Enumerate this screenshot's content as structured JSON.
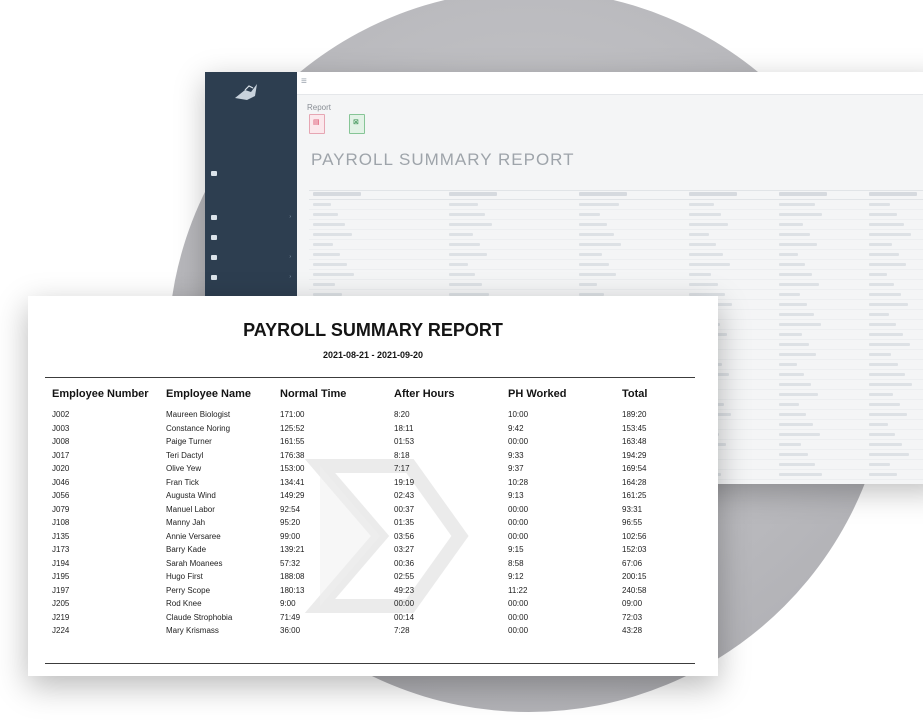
{
  "app": {
    "report_label": "Report",
    "title": "PAYROLL SUMMARY REPORT",
    "icons": {
      "menu": "hamburger-icon",
      "pdf": "pdf-file-icon",
      "excel": "excel-file-icon"
    }
  },
  "report": {
    "title": "PAYROLL SUMMARY REPORT",
    "date_range": "2021-08-21 - 2021-09-20",
    "columns": [
      "Employee Number",
      "Employee Name",
      "Normal Time",
      "After Hours",
      "PH Worked",
      "Total"
    ],
    "rows": [
      [
        "J002",
        "Maureen Biologist",
        "171:00",
        "8:20",
        "10:00",
        "189:20"
      ],
      [
        "J003",
        "Constance Noring",
        "125:52",
        "18:11",
        "9:42",
        "153:45"
      ],
      [
        "J008",
        "Paige Turner",
        "161:55",
        "01:53",
        "00:00",
        "163:48"
      ],
      [
        "J017",
        "Teri Dactyl",
        "176:38",
        "8:18",
        "9:33",
        "194:29"
      ],
      [
        "J020",
        "Olive Yew",
        "153:00",
        "7:17",
        "9:37",
        "169:54"
      ],
      [
        "J046",
        "Fran Tick",
        "134:41",
        "19:19",
        "10:28",
        "164:28"
      ],
      [
        "J056",
        "Augusta Wind",
        "149:29",
        "02:43",
        "9:13",
        "161:25"
      ],
      [
        "J079",
        "Manuel Labor",
        "92:54",
        "00:37",
        "00:00",
        "93:31"
      ],
      [
        "J108",
        "Manny Jah",
        "95:20",
        "01:35",
        "00:00",
        "96:55"
      ],
      [
        "J135",
        "Annie Versaree",
        "99:00",
        "03:56",
        "00:00",
        "102:56"
      ],
      [
        "J173",
        "Barry Kade",
        "139:21",
        "03:27",
        "9:15",
        "152:03"
      ],
      [
        "J194",
        "Sarah Moanees",
        "57:32",
        "00:36",
        "8:58",
        "67:06"
      ],
      [
        "J195",
        "Hugo First",
        "188:08",
        "02:55",
        "9:12",
        "200:15"
      ],
      [
        "J197",
        "Perry Scope",
        "180:13",
        "49:23",
        "11:22",
        "240:58"
      ],
      [
        "J205",
        "Rod Knee",
        "9:00",
        "00:00",
        "00:00",
        "09:00"
      ],
      [
        "J219",
        "Claude Strophobia",
        "71:49",
        "00:14",
        "00:00",
        "72:03"
      ],
      [
        "J224",
        "Mary Krismass",
        "36:00",
        "7:28",
        "00:00",
        "43:28"
      ]
    ],
    "watermark_icon": "sigma-logo-icon"
  }
}
